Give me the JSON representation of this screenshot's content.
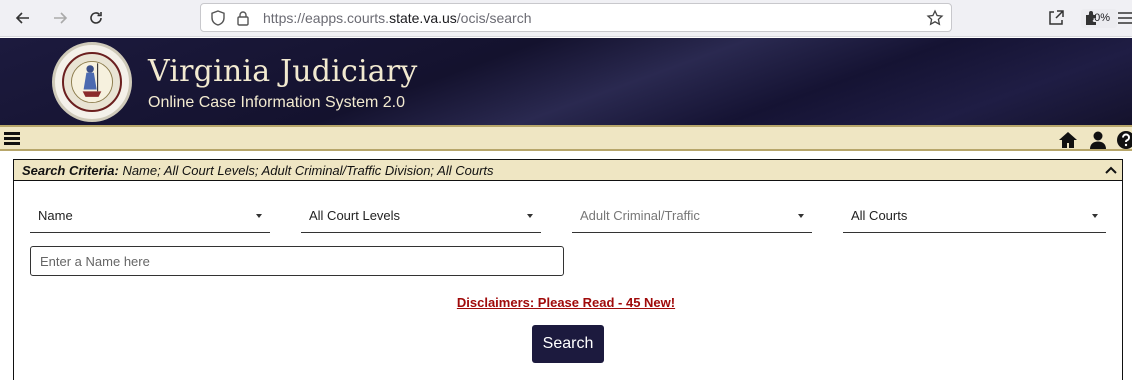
{
  "browser": {
    "url_prefix": "https://eapps.courts.",
    "url_host": "state.va.us",
    "url_suffix": "/ocis/search",
    "zoom": "80%"
  },
  "header": {
    "title": "Virginia Judiciary",
    "subtitle": "Online Case Information System 2.0",
    "logo": "virginia-seal"
  },
  "menubar": {
    "icons": [
      "menu-icon",
      "home-icon",
      "user-icon",
      "help-icon"
    ]
  },
  "criteria": {
    "label": "Search Criteria:",
    "value": " Name; All Court Levels; Adult Criminal/Traffic Division; All Courts"
  },
  "form": {
    "search_by": "Name",
    "court_level": "All Court Levels",
    "division": "Adult Criminal/Traffic",
    "court": "All Courts",
    "name_placeholder": "Enter a Name here",
    "disclaimer": "Disclaimers: Please Read - 45 New!",
    "search_label": "Search"
  },
  "colors": {
    "header_bg": "#1c1a3e",
    "accent_gold": "#efe6c3",
    "link_red": "#a00a0a"
  }
}
